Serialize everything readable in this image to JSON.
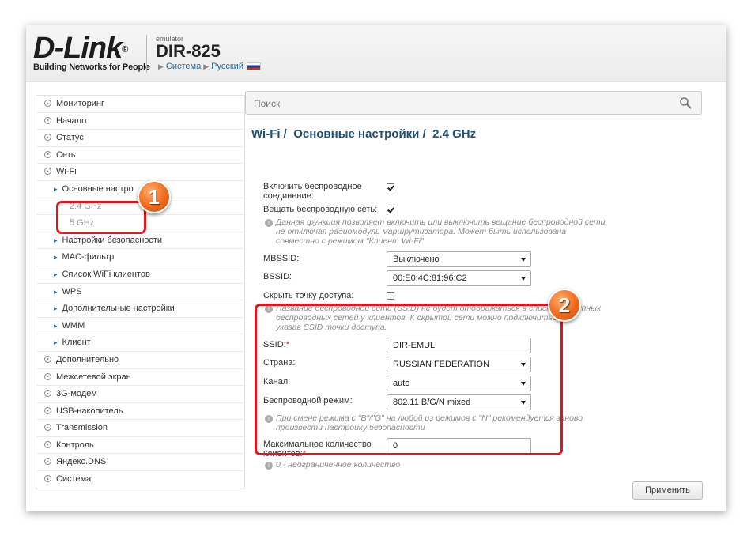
{
  "header": {
    "logo_text": "D-Link",
    "logo_reg": "®",
    "logo_tagline": "Building Networks for People",
    "emulator_label": "emulator",
    "model": "DIR-825",
    "crumb_system": "Система",
    "crumb_language": "Русский"
  },
  "sidebar": {
    "items": [
      {
        "label": "Мониторинг"
      },
      {
        "label": "Начало"
      },
      {
        "label": "Статус"
      },
      {
        "label": "Сеть"
      },
      {
        "label": "Wi-Fi"
      },
      {
        "label": "Основные настро"
      },
      {
        "label": "2.4 GHz"
      },
      {
        "label": "5 GHz"
      },
      {
        "label": "Настройки безопасности"
      },
      {
        "label": "MAC-фильтр"
      },
      {
        "label": "Список WiFi клиентов"
      },
      {
        "label": "WPS"
      },
      {
        "label": "Дополнительные настройки"
      },
      {
        "label": "WMM"
      },
      {
        "label": "Клиент"
      },
      {
        "label": "Дополнительно"
      },
      {
        "label": "Межсетевой экран"
      },
      {
        "label": "3G-модем"
      },
      {
        "label": "USB-накопитель"
      },
      {
        "label": "Transmission"
      },
      {
        "label": "Контроль"
      },
      {
        "label": "Яндекс.DNS"
      },
      {
        "label": "Система"
      }
    ]
  },
  "search": {
    "placeholder": "Поиск"
  },
  "breadcrumb": {
    "part1": "Wi-Fi /",
    "part2": "Основные настройки /",
    "part3": "2.4 GHz"
  },
  "form": {
    "enable_label_1": "Включить беспроводное",
    "enable_label_2": "соединение:",
    "enable_checked": true,
    "broadcast_label": "Вещать беспроводную сеть:",
    "broadcast_checked": true,
    "broadcast_hint_1": "Данная функция позволяет включить или выключить вещание беспроводной сети,",
    "broadcast_hint_2": "не отключая радиомодуль маршрутизатора. Может быть использована",
    "broadcast_hint_3": "совместно с режимом \"Клиент Wi-Fi\"",
    "mbssid_label": "MBSSID:",
    "mbssid_value": "Выключено",
    "bssid_label": "BSSID:",
    "bssid_value": "00:E0:4C:81:96:C2",
    "hide_label": "Скрыть точку доступа:",
    "hide_checked": false,
    "hide_hint_1": "Название беспроводной сети (SSID) не будет отображаться в списке доступных",
    "hide_hint_2": "беспроводных сетей у клиентов. К скрытой сети можно подключиться,",
    "hide_hint_3": "указав SSID точки доступа.",
    "ssid_label": "SSID:",
    "ssid_req": "*",
    "ssid_value": "DIR-EMUL",
    "country_label": "Страна:",
    "country_value": "RUSSIAN FEDERATION",
    "channel_label": "Канал:",
    "channel_value": "auto",
    "mode_label": "Беспроводной режим:",
    "mode_value": "802.11 B/G/N mixed",
    "mode_hint_1": "При смене режима с \"B\"/\"G\" на любой из режимов с \"N\" рекомендуется заново",
    "mode_hint_2": "произвести настройку безопасности",
    "max_label_1": "Максимальное количество",
    "max_label_2": "клиентов:",
    "max_req": "*",
    "max_value": "0",
    "max_hint": "0 - неограниченное количество",
    "apply_label": "Применить"
  },
  "annotations": {
    "badge1": "1",
    "badge2": "2"
  },
  "colors": {
    "accent": "#1d4f7a",
    "link": "#2a6a9c",
    "annotation_red": "#e0161c",
    "badge_orange": "#f06a1c"
  }
}
